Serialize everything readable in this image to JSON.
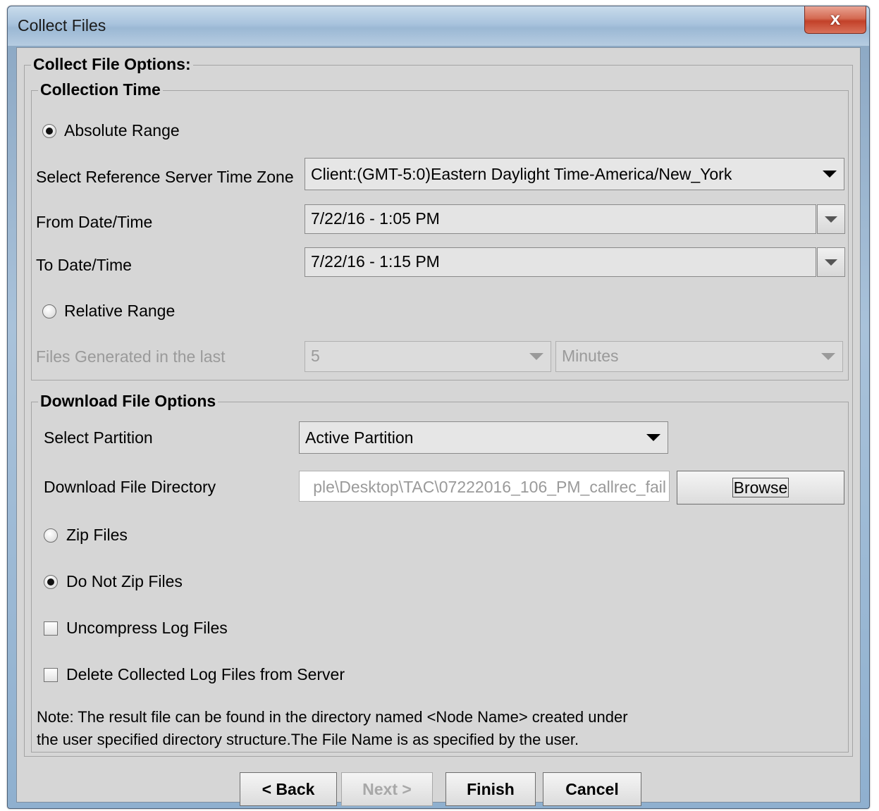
{
  "window": {
    "title": "Collect Files",
    "close_label": "x"
  },
  "options": {
    "legend": "Collect File Options:",
    "collection_time": {
      "legend": "Collection Time",
      "absolute_range_label": "Absolute Range",
      "absolute_selected": true,
      "timezone_label": "Select Reference Server Time Zone",
      "timezone_value": "Client:(GMT-5:0)Eastern Daylight Time-America/New_York",
      "from_label": "From Date/Time",
      "from_value": "7/22/16 - 1:05 PM",
      "to_label": "To Date/Time",
      "to_value": "7/22/16 - 1:15 PM",
      "relative_range_label": "Relative Range",
      "relative_selected": false,
      "files_generated_label": "Files Generated in the last",
      "files_generated_amount": "5",
      "files_generated_unit": "Minutes"
    },
    "download": {
      "legend": "Download File Options",
      "partition_label": "Select Partition",
      "partition_value": "Active Partition",
      "directory_label": "Download File Directory",
      "directory_value": "ple\\Desktop\\TAC\\07222016_106_PM_callrec_fail",
      "browse_label": "Browse",
      "zip_label": "Zip Files",
      "zip_selected": false,
      "no_zip_label": "Do Not Zip Files",
      "no_zip_selected": true,
      "uncompress_label": "Uncompress Log Files",
      "uncompress_checked": false,
      "delete_label": "Delete Collected Log Files from Server",
      "delete_checked": false,
      "note_line1": "Note: The result file can be found in the directory named <Node Name> created under",
      "note_line2": "the user specified directory structure.The File Name is as specified by the user."
    }
  },
  "buttons": {
    "back": "< Back",
    "next": "Next >",
    "finish": "Finish",
    "cancel": "Cancel"
  }
}
